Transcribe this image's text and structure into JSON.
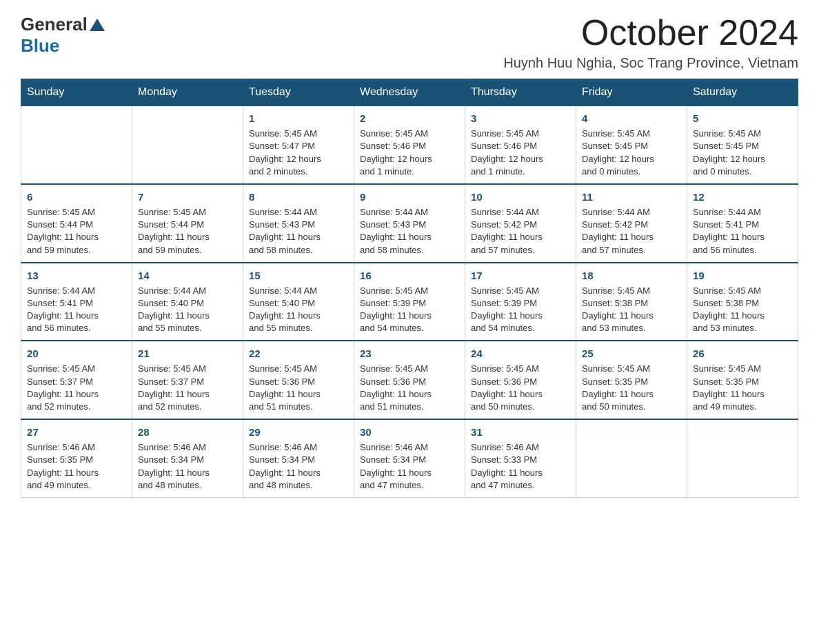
{
  "logo": {
    "general": "General",
    "triangle": "▲",
    "blue": "Blue"
  },
  "header": {
    "month_title": "October 2024",
    "location": "Huynh Huu Nghia, Soc Trang Province, Vietnam"
  },
  "weekdays": [
    "Sunday",
    "Monday",
    "Tuesday",
    "Wednesday",
    "Thursday",
    "Friday",
    "Saturday"
  ],
  "weeks": [
    [
      {
        "day": "",
        "info": ""
      },
      {
        "day": "",
        "info": ""
      },
      {
        "day": "1",
        "info": "Sunrise: 5:45 AM\nSunset: 5:47 PM\nDaylight: 12 hours\nand 2 minutes."
      },
      {
        "day": "2",
        "info": "Sunrise: 5:45 AM\nSunset: 5:46 PM\nDaylight: 12 hours\nand 1 minute."
      },
      {
        "day": "3",
        "info": "Sunrise: 5:45 AM\nSunset: 5:46 PM\nDaylight: 12 hours\nand 1 minute."
      },
      {
        "day": "4",
        "info": "Sunrise: 5:45 AM\nSunset: 5:45 PM\nDaylight: 12 hours\nand 0 minutes."
      },
      {
        "day": "5",
        "info": "Sunrise: 5:45 AM\nSunset: 5:45 PM\nDaylight: 12 hours\nand 0 minutes."
      }
    ],
    [
      {
        "day": "6",
        "info": "Sunrise: 5:45 AM\nSunset: 5:44 PM\nDaylight: 11 hours\nand 59 minutes."
      },
      {
        "day": "7",
        "info": "Sunrise: 5:45 AM\nSunset: 5:44 PM\nDaylight: 11 hours\nand 59 minutes."
      },
      {
        "day": "8",
        "info": "Sunrise: 5:44 AM\nSunset: 5:43 PM\nDaylight: 11 hours\nand 58 minutes."
      },
      {
        "day": "9",
        "info": "Sunrise: 5:44 AM\nSunset: 5:43 PM\nDaylight: 11 hours\nand 58 minutes."
      },
      {
        "day": "10",
        "info": "Sunrise: 5:44 AM\nSunset: 5:42 PM\nDaylight: 11 hours\nand 57 minutes."
      },
      {
        "day": "11",
        "info": "Sunrise: 5:44 AM\nSunset: 5:42 PM\nDaylight: 11 hours\nand 57 minutes."
      },
      {
        "day": "12",
        "info": "Sunrise: 5:44 AM\nSunset: 5:41 PM\nDaylight: 11 hours\nand 56 minutes."
      }
    ],
    [
      {
        "day": "13",
        "info": "Sunrise: 5:44 AM\nSunset: 5:41 PM\nDaylight: 11 hours\nand 56 minutes."
      },
      {
        "day": "14",
        "info": "Sunrise: 5:44 AM\nSunset: 5:40 PM\nDaylight: 11 hours\nand 55 minutes."
      },
      {
        "day": "15",
        "info": "Sunrise: 5:44 AM\nSunset: 5:40 PM\nDaylight: 11 hours\nand 55 minutes."
      },
      {
        "day": "16",
        "info": "Sunrise: 5:45 AM\nSunset: 5:39 PM\nDaylight: 11 hours\nand 54 minutes."
      },
      {
        "day": "17",
        "info": "Sunrise: 5:45 AM\nSunset: 5:39 PM\nDaylight: 11 hours\nand 54 minutes."
      },
      {
        "day": "18",
        "info": "Sunrise: 5:45 AM\nSunset: 5:38 PM\nDaylight: 11 hours\nand 53 minutes."
      },
      {
        "day": "19",
        "info": "Sunrise: 5:45 AM\nSunset: 5:38 PM\nDaylight: 11 hours\nand 53 minutes."
      }
    ],
    [
      {
        "day": "20",
        "info": "Sunrise: 5:45 AM\nSunset: 5:37 PM\nDaylight: 11 hours\nand 52 minutes."
      },
      {
        "day": "21",
        "info": "Sunrise: 5:45 AM\nSunset: 5:37 PM\nDaylight: 11 hours\nand 52 minutes."
      },
      {
        "day": "22",
        "info": "Sunrise: 5:45 AM\nSunset: 5:36 PM\nDaylight: 11 hours\nand 51 minutes."
      },
      {
        "day": "23",
        "info": "Sunrise: 5:45 AM\nSunset: 5:36 PM\nDaylight: 11 hours\nand 51 minutes."
      },
      {
        "day": "24",
        "info": "Sunrise: 5:45 AM\nSunset: 5:36 PM\nDaylight: 11 hours\nand 50 minutes."
      },
      {
        "day": "25",
        "info": "Sunrise: 5:45 AM\nSunset: 5:35 PM\nDaylight: 11 hours\nand 50 minutes."
      },
      {
        "day": "26",
        "info": "Sunrise: 5:45 AM\nSunset: 5:35 PM\nDaylight: 11 hours\nand 49 minutes."
      }
    ],
    [
      {
        "day": "27",
        "info": "Sunrise: 5:46 AM\nSunset: 5:35 PM\nDaylight: 11 hours\nand 49 minutes."
      },
      {
        "day": "28",
        "info": "Sunrise: 5:46 AM\nSunset: 5:34 PM\nDaylight: 11 hours\nand 48 minutes."
      },
      {
        "day": "29",
        "info": "Sunrise: 5:46 AM\nSunset: 5:34 PM\nDaylight: 11 hours\nand 48 minutes."
      },
      {
        "day": "30",
        "info": "Sunrise: 5:46 AM\nSunset: 5:34 PM\nDaylight: 11 hours\nand 47 minutes."
      },
      {
        "day": "31",
        "info": "Sunrise: 5:46 AM\nSunset: 5:33 PM\nDaylight: 11 hours\nand 47 minutes."
      },
      {
        "day": "",
        "info": ""
      },
      {
        "day": "",
        "info": ""
      }
    ]
  ]
}
